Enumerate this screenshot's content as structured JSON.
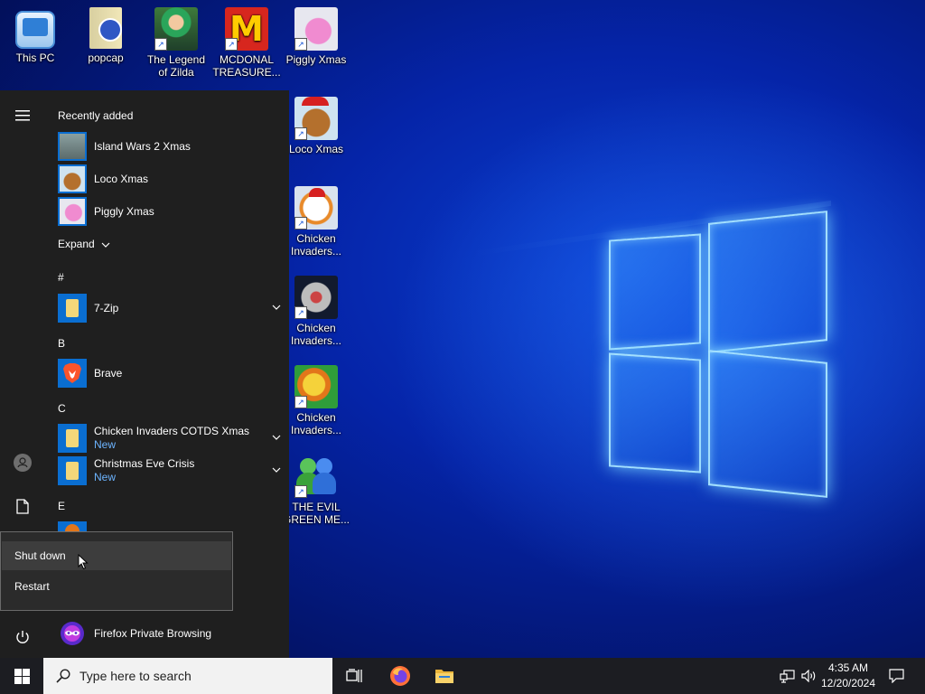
{
  "desktop": {
    "icons": [
      {
        "label": "This PC",
        "icon": "monitor-icon"
      },
      {
        "label": "popcap",
        "icon": "folder-icon"
      },
      {
        "label": "The Legend of Zilda",
        "icon": "game-icon"
      },
      {
        "label": "MCDONAL TREASURE...",
        "icon": "game-icon"
      },
      {
        "label": "Piggly Xmas",
        "icon": "game-icon"
      },
      {
        "label": "Loco Xmas",
        "icon": "game-icon"
      },
      {
        "label": "Chicken Invaders...",
        "icon": "game-icon"
      },
      {
        "label": "Chicken Invaders...",
        "icon": "game-icon"
      },
      {
        "label": "Chicken Invaders...",
        "icon": "game-icon"
      },
      {
        "label": "THE EVIL GREEN ME...",
        "icon": "game-icon"
      }
    ]
  },
  "start_menu": {
    "recently_added_label": "Recently added",
    "recent": [
      {
        "name": "Island Wars 2 Xmas"
      },
      {
        "name": "Loco Xmas"
      },
      {
        "name": "Piggly Xmas"
      }
    ],
    "expand_label": "Expand",
    "sections": {
      "hash": "#",
      "b": "B",
      "c": "C",
      "e": "E"
    },
    "apps": {
      "seven_zip": "7-Zip",
      "brave": "Brave",
      "chicken_invaders": {
        "name": "Chicken Invaders COTDS Xmas",
        "badge": "New"
      },
      "christmas_eve": {
        "name": "Christmas Eve Crisis",
        "badge": "New"
      },
      "firefox_private": "Firefox Private Browsing"
    }
  },
  "power_flyout": {
    "items": [
      "Shut down",
      "Restart"
    ]
  },
  "taskbar": {
    "search_placeholder": "Type here to search",
    "time": "4:35 AM",
    "date": "12/20/2024"
  },
  "colors": {
    "accent": "#0a6ed1",
    "start_bg": "#1f1f1f",
    "taskbar_bg": "#1c1d22",
    "new_badge": "#6cb4ff"
  }
}
